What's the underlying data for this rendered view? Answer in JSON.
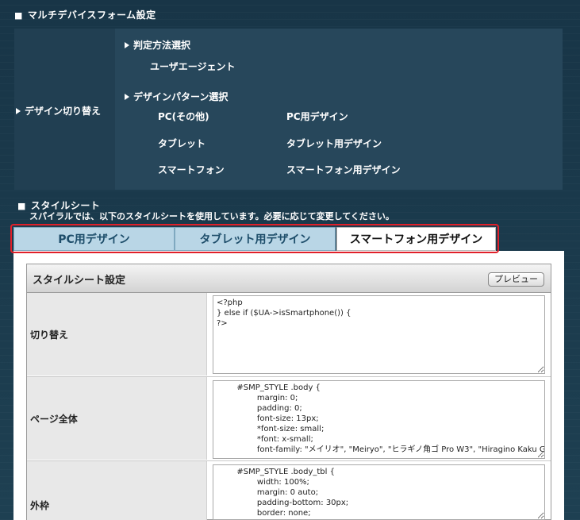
{
  "multidevice": {
    "section_title": "マルチデバイスフォーム設定",
    "row_label": "デザイン切り替え",
    "detection_heading": "判定方法選択",
    "detection_value": "ユーザエージェント",
    "pattern_heading": "デザインパターン選択",
    "patterns": [
      {
        "device": "PC(その他)",
        "design": "PC用デザイン"
      },
      {
        "device": "タブレット",
        "design": "タブレット用デザイン"
      },
      {
        "device": "スマートフォン",
        "design": "スマートフォン用デザイン"
      }
    ]
  },
  "stylesheet": {
    "section_title": "スタイルシート",
    "description": "スパイラルでは、以下のスタイルシートを使用しています。必要に応じて変更してください。"
  },
  "tabs": [
    {
      "label": "PC用デザイン",
      "active": false
    },
    {
      "label": "タブレット用デザイン",
      "active": false
    },
    {
      "label": "スマートフォン用デザイン",
      "active": true
    }
  ],
  "panel": {
    "title": "スタイルシート設定",
    "preview_button": "プレビュー"
  },
  "rows": [
    {
      "label": "切り替え",
      "code": "<?php\n} else if ($UA->isSmartphone()) {\n?>"
    },
    {
      "label": "ページ全体",
      "code": "        #SMP_STYLE .body {\n                margin: 0;\n                padding: 0;\n                font-size: 13px;\n                *font-size: small;\n                *font: x-small;\n                font-family: \"メイリオ\", \"Meiryo\", \"ヒラギノ角ゴ Pro W3\", \"Hiragino Kaku Gothic Pro\";"
    },
    {
      "label": "外枠",
      "code": "        #SMP_STYLE .body_tbl {\n                width: 100%;\n                margin: 0 auto;\n                padding-bottom: 30px;\n                border: none;"
    }
  ],
  "colors": {
    "page_bg": "#1b3a4b",
    "panel_bg": "#27475b",
    "tab_inactive": "#b9d6e6",
    "highlight_border": "#e0202a"
  }
}
